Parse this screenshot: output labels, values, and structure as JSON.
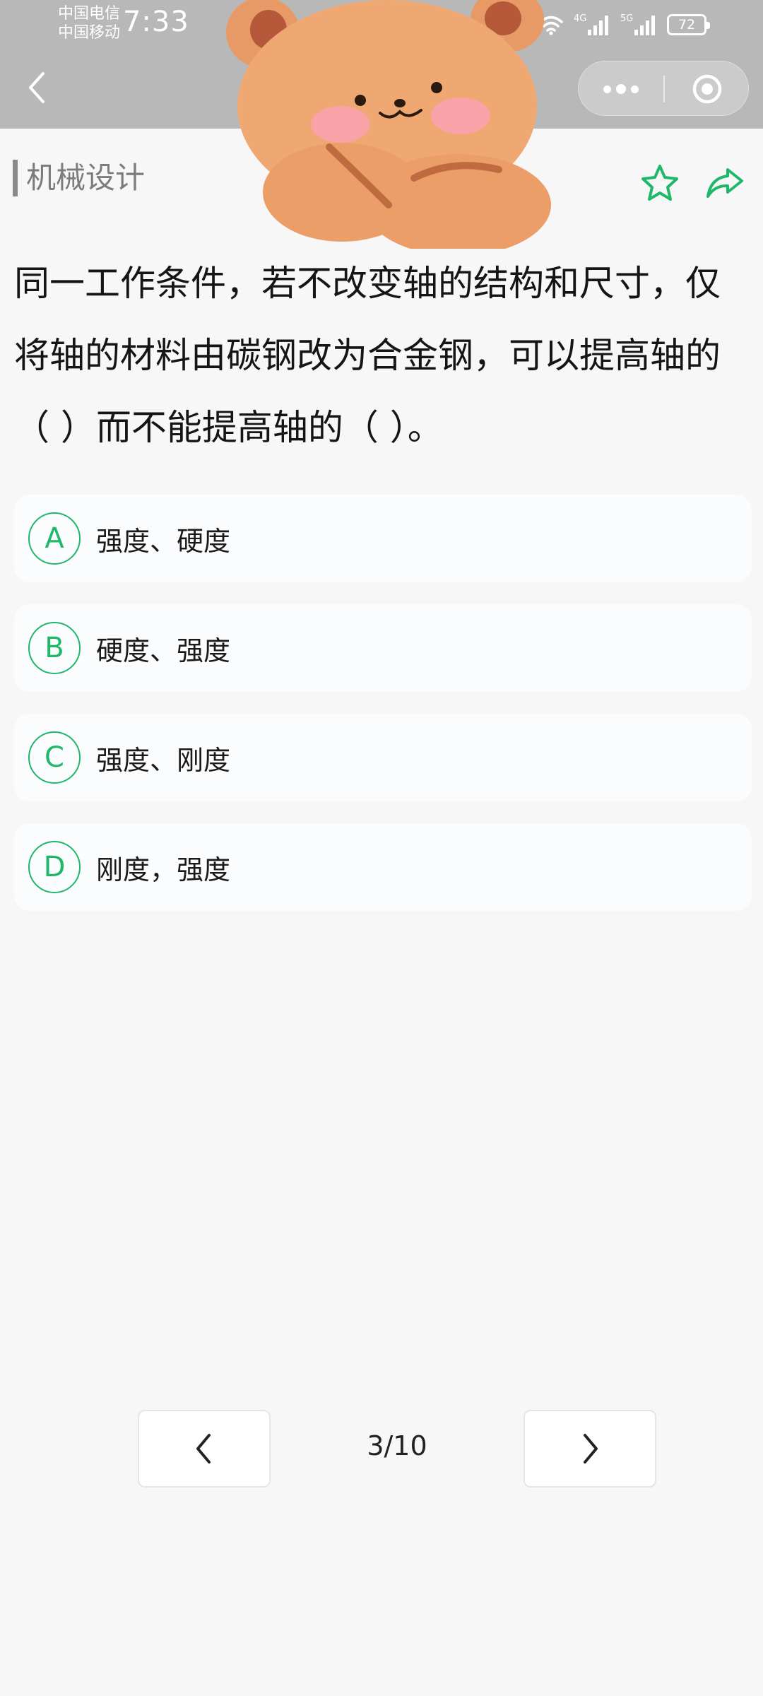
{
  "status_bar": {
    "carrier1": "中国电信",
    "carrier2": "中国移动",
    "time": "7:33",
    "net1": "4G",
    "net2": "5G",
    "battery": "72"
  },
  "header": {
    "category": "机械设计"
  },
  "question": {
    "text": "同一工作条件，若不改变轴的结构和尺寸，仅将轴的材料由碳钢改为合金钢，可以提高轴的（ ）而不能提高轴的（ ）。"
  },
  "options": [
    {
      "letter": "A",
      "text": "强度、硬度"
    },
    {
      "letter": "B",
      "text": "硬度、强度"
    },
    {
      "letter": "C",
      "text": "强度、刚度"
    },
    {
      "letter": "D",
      "text": "刚度，强度"
    }
  ],
  "pager": {
    "indicator": "3/10"
  },
  "colors": {
    "accent": "#1fb86a",
    "header_bg": "#b8b8b8",
    "page_bg": "#f7f7f7"
  },
  "icons": {
    "back": "chevron-left-icon",
    "more": "more-dots-icon",
    "close": "target-circle-icon",
    "favorite": "star-outline-icon",
    "share": "share-arrow-icon",
    "prev": "chevron-left-icon",
    "next": "chevron-right-icon"
  }
}
